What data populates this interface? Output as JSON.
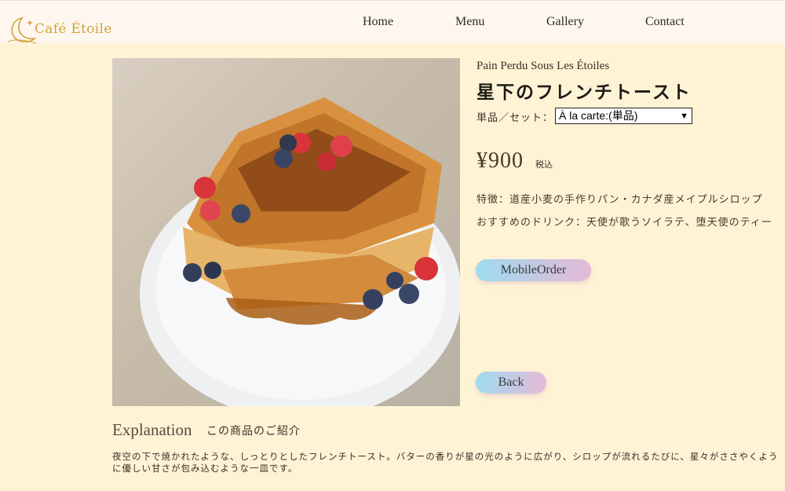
{
  "header": {
    "logo_text": "Café Étoile",
    "nav": [
      "Home",
      "Menu",
      "Gallery",
      "Contact"
    ]
  },
  "product": {
    "subtitle": "Pain Perdu Sous Les Étoiles",
    "title": "星下のフレンチトースト",
    "set_label": "単品／セット：",
    "set_selected": "À la carte:(単品)",
    "price": "¥900",
    "tax": "税込",
    "features": "特徴：道産小麦の手作りパン・カナダ産メイプルシロップ",
    "drinks": "おすすめのドリンク：天使が歌うソイラテ、堕天使のティー",
    "order_button": "MobileOrder",
    "back_button": "Back"
  },
  "explanation": {
    "heading": "Explanation",
    "subheading": "この商品のご紹介",
    "body": "夜空の下で焼かれたような、しっとりとしたフレンチトースト。バターの香りが星の光のように広がり、シロップが流れるたびに、星々がささやくように優しい甘さが包み込むような一皿です。"
  },
  "colors": {
    "page_bg": "#fff3d6",
    "header_bg": "#fdf7f0",
    "logo_gold": "#d4a33a",
    "button_gradient_start": "#9edcf0",
    "button_gradient_end": "#e5b9d6"
  }
}
